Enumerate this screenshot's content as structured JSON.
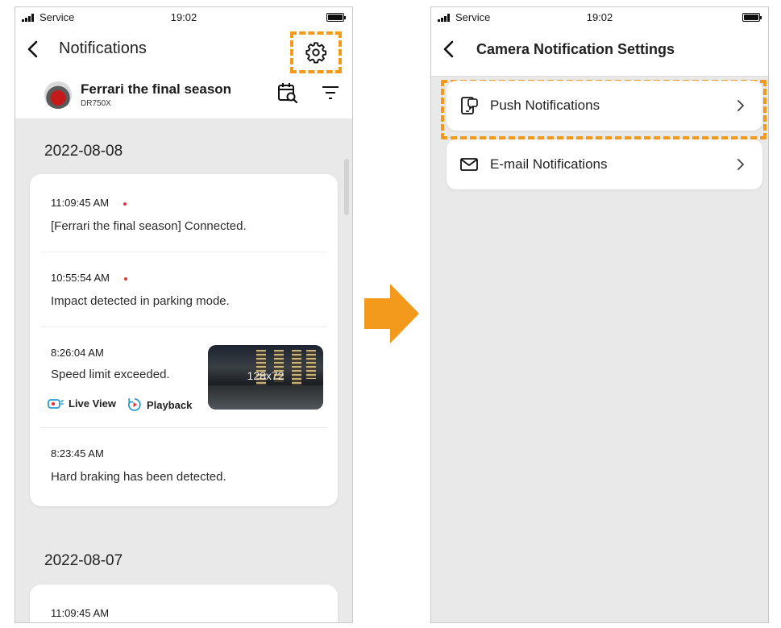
{
  "status_bar": {
    "carrier": "Service",
    "time": "19:02"
  },
  "colors": {
    "accent": "#f39a1c",
    "badge_dot": "#e0363c",
    "background": "#e9e9e9"
  },
  "left_screen": {
    "title": "Notifications",
    "device": {
      "name": "Ferrari the final season",
      "model": "DR750X"
    },
    "icons": {
      "back": "chevron-left-icon",
      "settings": "gear-icon",
      "calendar_search": "calendar-search-icon",
      "filter": "filter-icon"
    },
    "groups": [
      {
        "date": "2022-08-08",
        "entries": [
          {
            "time": "11:09:45 AM",
            "message": "[Ferrari the final season] Connected.",
            "unread": true
          },
          {
            "time": "10:55:54 AM",
            "message": "Impact detected in parking mode.",
            "unread": true
          },
          {
            "time": "8:26:04 AM",
            "message": "Speed limit exceeded.",
            "unread": false,
            "thumbnail_label": "128x72",
            "actions": [
              "Live View",
              "Playback"
            ]
          },
          {
            "time": "8:23:45 AM",
            "message": "Hard braking has been detected.",
            "unread": false
          }
        ]
      },
      {
        "date": "2022-08-07",
        "entries": [
          {
            "time": "11:09:45 AM"
          }
        ]
      }
    ]
  },
  "right_screen": {
    "title": "Camera Notification Settings",
    "items": [
      {
        "label": "Push Notifications",
        "icon": "phone-chat-icon"
      },
      {
        "label": "E-mail Notifications",
        "icon": "envelope-icon"
      }
    ]
  }
}
